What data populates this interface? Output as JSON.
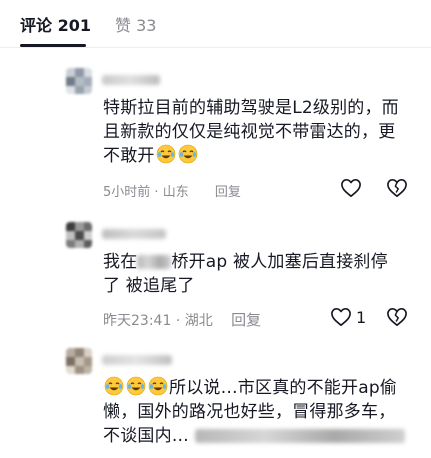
{
  "tabs": {
    "comments_label": "评论",
    "comments_count": "201",
    "likes_label": "赞",
    "likes_count": "33"
  },
  "comments": [
    {
      "text_line1": "特斯拉目前的辅助驾驶是L2级别的，而",
      "text_line2": "且新款的仅仅是纯视觉不带雷达的，更",
      "text_line3": "不敢开",
      "time": "5小时前",
      "location": "山东",
      "reply_label": "回复",
      "like_count": ""
    },
    {
      "text_prefix": "我在",
      "text_suffix": "桥开ap 被人加塞后直接刹停",
      "text_line2": "了 被追尾了",
      "time": "昨天23:41",
      "location": "湖北",
      "reply_label": "回复",
      "like_count": "1"
    },
    {
      "text_line1": "所以说…市区真的不能开ap偷",
      "text_line2": "懒，国外的路况也好些，冒得那多车，",
      "text_line3": "不谈国内…"
    }
  ],
  "icons": {
    "like": "heart-outline-icon",
    "dislike": "broken-heart-icon",
    "emoji_laugh_cry": "laughing-crying-emoji-icon"
  },
  "colors": {
    "primary_text": "#161823",
    "secondary_text": "#8a8b91",
    "emoji_face": "#ffc83d"
  }
}
